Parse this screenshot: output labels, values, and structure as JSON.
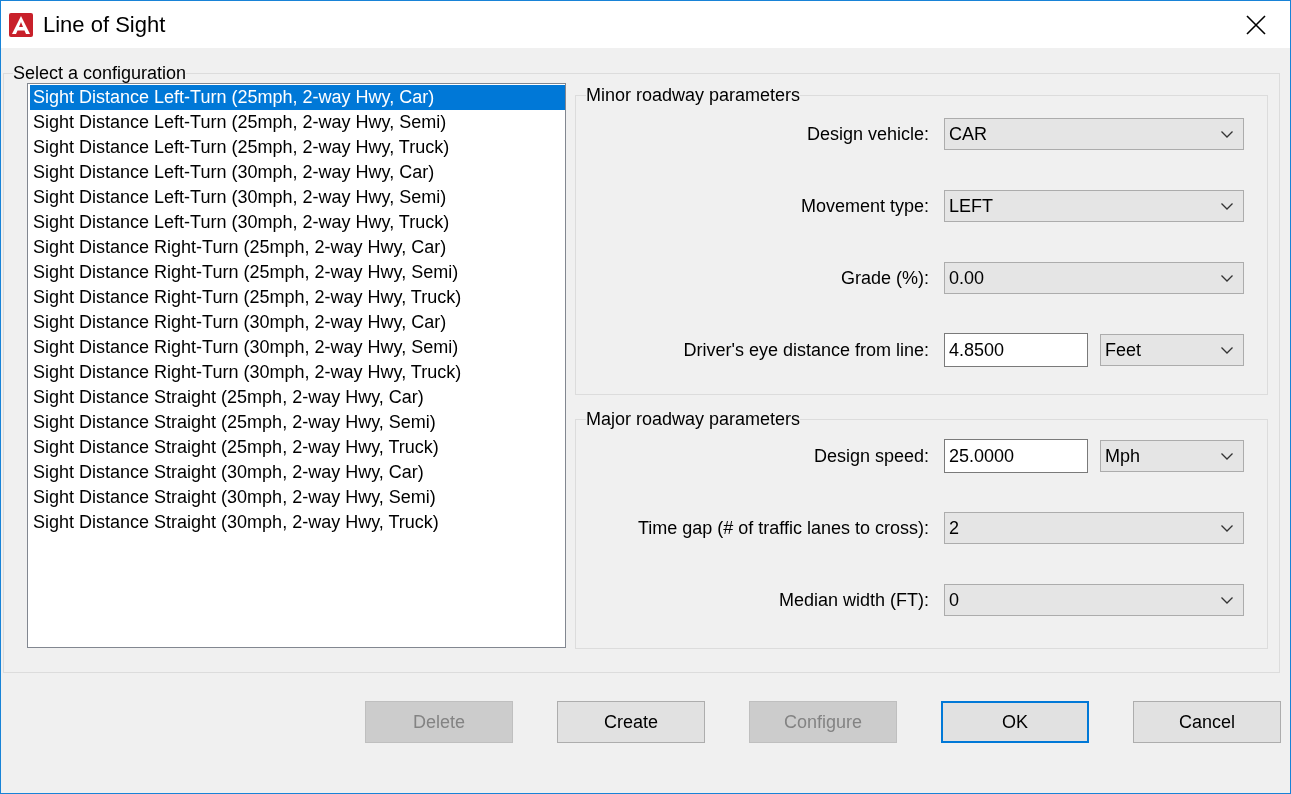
{
  "window": {
    "title": "Line of Sight"
  },
  "configuration_group": {
    "label": "Select a configuration",
    "items": [
      {
        "label": "Sight Distance Left-Turn (25mph, 2-way Hwy, Car)",
        "selected": true
      },
      {
        "label": "Sight Distance Left-Turn (25mph, 2-way Hwy, Semi)",
        "selected": false
      },
      {
        "label": "Sight Distance Left-Turn (25mph, 2-way Hwy, Truck)",
        "selected": false
      },
      {
        "label": "Sight Distance Left-Turn (30mph, 2-way Hwy, Car)",
        "selected": false
      },
      {
        "label": "Sight Distance Left-Turn (30mph, 2-way Hwy, Semi)",
        "selected": false
      },
      {
        "label": "Sight Distance Left-Turn (30mph, 2-way Hwy, Truck)",
        "selected": false
      },
      {
        "label": "Sight Distance Right-Turn (25mph, 2-way Hwy, Car)",
        "selected": false
      },
      {
        "label": "Sight Distance Right-Turn (25mph, 2-way Hwy, Semi)",
        "selected": false
      },
      {
        "label": "Sight Distance Right-Turn (25mph, 2-way Hwy, Truck)",
        "selected": false
      },
      {
        "label": "Sight Distance Right-Turn (30mph, 2-way Hwy, Car)",
        "selected": false
      },
      {
        "label": "Sight Distance Right-Turn (30mph, 2-way Hwy, Semi)",
        "selected": false
      },
      {
        "label": "Sight Distance Right-Turn (30mph, 2-way Hwy, Truck)",
        "selected": false
      },
      {
        "label": "Sight Distance Straight (25mph, 2-way Hwy, Car)",
        "selected": false
      },
      {
        "label": "Sight Distance Straight (25mph, 2-way Hwy, Semi)",
        "selected": false
      },
      {
        "label": "Sight Distance Straight (25mph, 2-way Hwy, Truck)",
        "selected": false
      },
      {
        "label": "Sight Distance Straight (30mph, 2-way Hwy, Car)",
        "selected": false
      },
      {
        "label": "Sight Distance Straight (30mph, 2-way Hwy, Semi)",
        "selected": false
      },
      {
        "label": "Sight Distance Straight (30mph, 2-way Hwy, Truck)",
        "selected": false
      }
    ]
  },
  "minor_roadway": {
    "label": "Minor roadway parameters",
    "fields": [
      {
        "kind": "dropdown",
        "label": "Design vehicle:",
        "value": "CAR"
      },
      {
        "kind": "dropdown",
        "label": "Movement type:",
        "value": "LEFT"
      },
      {
        "kind": "dropdown",
        "label": "Grade (%):",
        "value": "0.00"
      },
      {
        "kind": "input_unit",
        "label": "Driver's eye distance from line:",
        "value": "4.8500",
        "unit": "Feet"
      }
    ]
  },
  "major_roadway": {
    "label": "Major roadway parameters",
    "fields": [
      {
        "kind": "input_unit",
        "label": "Design speed:",
        "value": "25.0000",
        "unit": "Mph"
      },
      {
        "kind": "dropdown",
        "label": "Time gap (# of traffic lanes to cross):",
        "value": "2"
      },
      {
        "kind": "dropdown",
        "label": "Median width (FT):",
        "value": "0"
      }
    ]
  },
  "buttons": [
    {
      "label": "Delete",
      "disabled": true,
      "default": false
    },
    {
      "label": "Create",
      "disabled": false,
      "default": false
    },
    {
      "label": "Configure",
      "disabled": true,
      "default": false
    },
    {
      "label": "OK",
      "disabled": false,
      "default": true
    },
    {
      "label": "Cancel",
      "disabled": false,
      "default": false
    }
  ]
}
